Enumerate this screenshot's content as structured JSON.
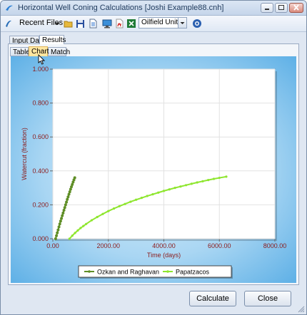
{
  "window": {
    "title": "Horizontal Well Coning Calculations [Joshi Example88.cnh]"
  },
  "toolbar": {
    "recent_files_label": "Recent Files",
    "units_value": "Oilfield Units",
    "icons": [
      "open-folder-icon",
      "save-icon",
      "document-icon",
      "monitor-icon",
      "pdf-icon",
      "excel-icon",
      "help-icon"
    ]
  },
  "tabs": {
    "main": [
      {
        "label": "Input Data"
      },
      {
        "label": "Results"
      }
    ],
    "sub": [
      {
        "label": "Table"
      },
      {
        "label": "Chart"
      },
      {
        "label": "Match"
      }
    ],
    "active_main": "Results",
    "active_sub": "Chart"
  },
  "colors": {
    "series1": "#5f8e26",
    "series2": "#8ee62e",
    "axis_text": "#8b1a1a",
    "plot_bg": "#ffffff",
    "chart_bg_edge": "#5eb0e6"
  },
  "chart_data": {
    "type": "line",
    "xlabel": "Time (days)",
    "ylabel": "Watercut (fraction)",
    "xlim": [
      0,
      8000
    ],
    "ylim": [
      0,
      1
    ],
    "x_ticks": [
      "0.00",
      "2000.00",
      "4000.00",
      "6000.00",
      "8000.00"
    ],
    "y_ticks": [
      "0.000",
      "0.200",
      "0.400",
      "0.600",
      "0.800",
      "1.000"
    ],
    "grid": true,
    "legend_placement": "bottom",
    "series": [
      {
        "name": "Ozkan and Raghavan",
        "x": [
          100,
          130,
          160,
          190,
          220,
          250,
          280,
          310,
          340,
          370,
          400,
          430,
          460,
          490,
          520,
          550,
          580,
          610,
          640,
          670,
          700,
          730,
          760,
          790
        ],
        "y": [
          0.0,
          0.018,
          0.035,
          0.052,
          0.07,
          0.087,
          0.104,
          0.12,
          0.136,
          0.152,
          0.168,
          0.184,
          0.2,
          0.216,
          0.232,
          0.247,
          0.262,
          0.277,
          0.292,
          0.306,
          0.32,
          0.334,
          0.347,
          0.36
        ]
      },
      {
        "name": "Papatzacos",
        "x": [
          600,
          700,
          800,
          900,
          1000,
          1100,
          1200,
          1400,
          1600,
          1800,
          2000,
          2200,
          2400,
          2600,
          2800,
          3000,
          3200,
          3400,
          3600,
          3800,
          4000,
          4200,
          4400,
          4600,
          4800,
          5000,
          5200,
          5400,
          5600,
          5800,
          6000,
          6250
        ],
        "y": [
          0.0,
          0.018,
          0.034,
          0.049,
          0.063,
          0.075,
          0.087,
          0.109,
          0.128,
          0.146,
          0.163,
          0.178,
          0.192,
          0.205,
          0.218,
          0.23,
          0.241,
          0.252,
          0.262,
          0.272,
          0.282,
          0.291,
          0.3,
          0.308,
          0.316,
          0.324,
          0.332,
          0.339,
          0.346,
          0.353,
          0.359,
          0.366
        ]
      }
    ]
  },
  "buttons": {
    "calculate": "Calculate",
    "close": "Close"
  }
}
